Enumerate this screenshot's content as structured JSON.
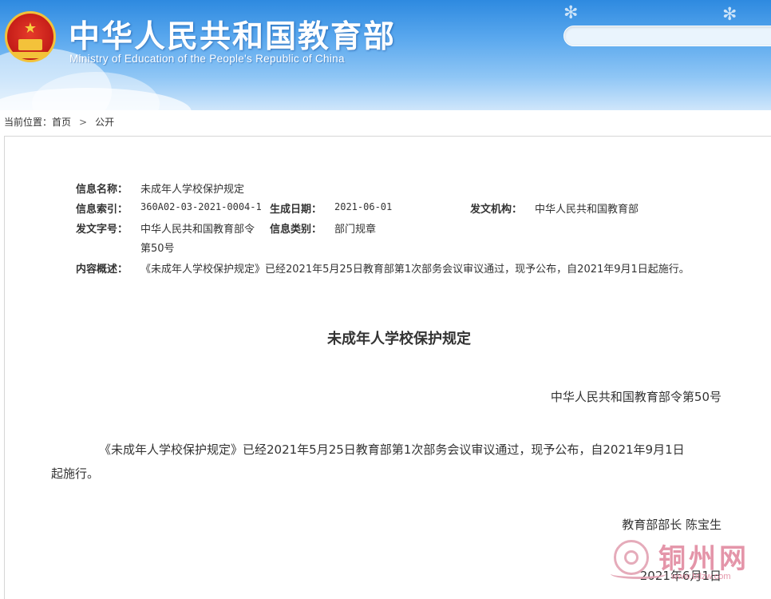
{
  "header": {
    "title": "中华人民共和国教育部",
    "subtitle": "Ministry of Education of the People's Republic of China",
    "search_value": ""
  },
  "breadcrumb": {
    "prefix": "当前位置：",
    "home": "首页",
    "separator": ">",
    "current": "公开"
  },
  "meta": {
    "name_label": "信息名称：",
    "name_value": "未成年人学校保护规定",
    "index_label": "信息索引：",
    "index_value": "360A02-03-2021-0004-1",
    "date_label": "生成日期：",
    "date_value": "2021-06-01",
    "issuer_label": "发文机构：",
    "issuer_value": "中华人民共和国教育部",
    "docno_label": "发文字号：",
    "docno_value_line1": "中华人民共和国教育部令",
    "docno_value_line2": "第50号",
    "category_label": "信息类别：",
    "category_value": "部门规章",
    "summary_label": "内容概述：",
    "summary_value": "《未成年人学校保护规定》已经2021年5月25日教育部第1次部务会议审议通过，现予公布，自2021年9月1日起施行。"
  },
  "document": {
    "title": "未成年人学校保护规定",
    "order_no": "中华人民共和国教育部令第50号",
    "body_line1": "《未成年人学校保护规定》已经2021年5月25日教育部第1次部务会议审议通过，现予公布，自2021年9月1日",
    "body_line2": "起施行。",
    "signer": "教育部部长 陈宝生",
    "sign_date": "2021年6月1日"
  },
  "watermark": {
    "text": "铜州网",
    "url": "www.btlzw.com"
  },
  "colors": {
    "header_top": "#2e8ae0",
    "header_bottom": "#cfe6fb",
    "emblem_red": "#c8201a",
    "emblem_gold": "#f3c23a",
    "watermark_pink": "#e28aa0"
  }
}
